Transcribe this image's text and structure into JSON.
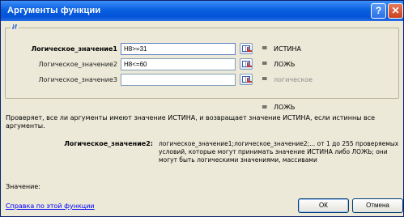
{
  "window": {
    "title": "Аргументы функции",
    "help_glyph": "?",
    "close_glyph": "✕"
  },
  "group": {
    "legend": "И"
  },
  "args": [
    {
      "label": "Логическое_значение1",
      "value": "H8>=31",
      "result": "ИСТИНА",
      "active": true
    },
    {
      "label": "Логическое_значение2",
      "value": "H8<=60",
      "result": "ЛОЖЬ",
      "active": false
    },
    {
      "label": "Логическое_значение3",
      "value": "",
      "result": "логическое",
      "active": false
    }
  ],
  "equals_sign": "=",
  "total_result": "ЛОЖЬ",
  "description": "Проверяет, все ли аргументы имеют значение ИСТИНА, и возвращает значение ИСТИНА, если истинны все аргументы.",
  "selected_arg": {
    "name": "Логическое_значение2:",
    "text": "логическое_значение1;логическое_значение2;... от 1 до 255 проверяемых условий, которые могут принимать значение ИСТИНА либо ЛОЖЬ; они могут быть логическими значениями, массивами"
  },
  "value_label": "Значение:",
  "help_link": "Справка по этой функции",
  "buttons": {
    "ok": "ОК",
    "cancel": "Отмена"
  },
  "colors": {
    "title_bar": "#0453d8",
    "link": "#0000ff",
    "dialog_bg": "#ece9d8"
  }
}
